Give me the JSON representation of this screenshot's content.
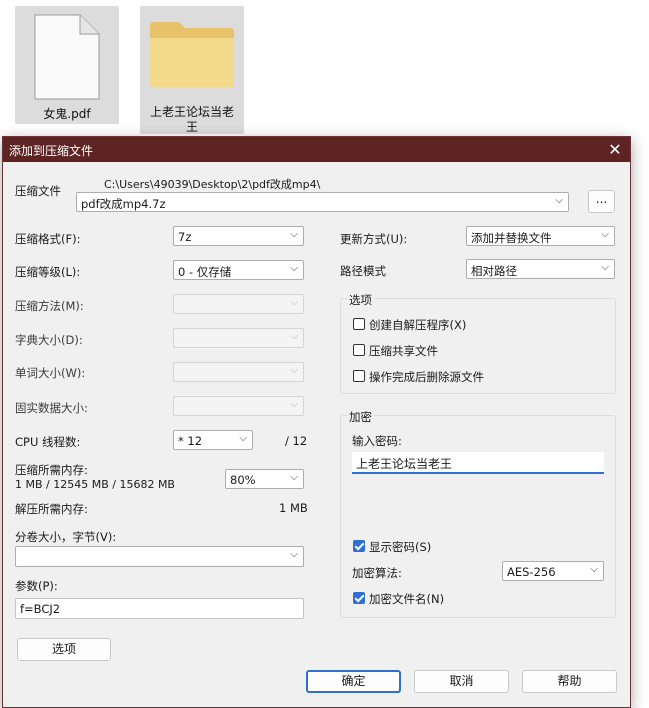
{
  "desktop": {
    "items": [
      {
        "label": "女鬼.pdf",
        "icon": "pdf-file-icon"
      },
      {
        "label": "上老王论坛当老王",
        "icon": "folder-icon"
      }
    ]
  },
  "dialog": {
    "title": "添加到压缩文件",
    "close_glyph": "✕",
    "archive": {
      "label": "压缩文件",
      "path": "C:\\Users\\49039\\Desktop\\2\\pdf改成mp4\\",
      "filename": "pdf改成mp4.7z",
      "browse_label": "..."
    },
    "left": {
      "format": {
        "label": "压缩格式(F):",
        "value": "7z"
      },
      "level": {
        "label": "压缩等级(L):",
        "value": "0 - 仅存储"
      },
      "method": {
        "label": "压缩方法(M):",
        "value": ""
      },
      "dictionary": {
        "label": "字典大小(D):",
        "value": ""
      },
      "word": {
        "label": "单词大小(W):",
        "value": ""
      },
      "solid": {
        "label": "固实数据大小:",
        "value": ""
      },
      "cpu": {
        "label": "CPU 线程数:",
        "value": "* 12",
        "total": "/ 12"
      },
      "mem_compress": {
        "label": "压缩所需内存:",
        "detail": "1 MB / 12545 MB / 15682 MB",
        "value": "80%"
      },
      "mem_decompress": {
        "label": "解压所需内存:",
        "value": "1 MB"
      },
      "volume": {
        "label": "分卷大小，字节(V):",
        "value": ""
      },
      "params": {
        "label": "参数(P):",
        "value": "f=BCJ2"
      },
      "options_button": "选项"
    },
    "right": {
      "update": {
        "label": "更新方式(U):",
        "value": "添加并替换文件"
      },
      "path_mode": {
        "label": "路径模式",
        "value": "相对路径"
      },
      "options_group": {
        "title": "选项",
        "sfx": {
          "label": "创建自解压程序(X)",
          "checked": false
        },
        "shared": {
          "label": "压缩共享文件",
          "checked": false
        },
        "delete": {
          "label": "操作完成后删除源文件",
          "checked": false
        }
      },
      "encryption": {
        "title": "加密",
        "password_label": "输入密码:",
        "password_value": "上老王论坛当老王",
        "show_password": {
          "label": "显示密码(S)",
          "checked": true
        },
        "method_label": "加密算法:",
        "method_value": "AES-256",
        "encrypt_names": {
          "label": "加密文件名(N)",
          "checked": true
        }
      }
    },
    "buttons": {
      "ok": "确定",
      "cancel": "取消",
      "help": "帮助"
    },
    "colors": {
      "titlebar": "#5e2424",
      "accent": "#2f6fd1"
    }
  }
}
